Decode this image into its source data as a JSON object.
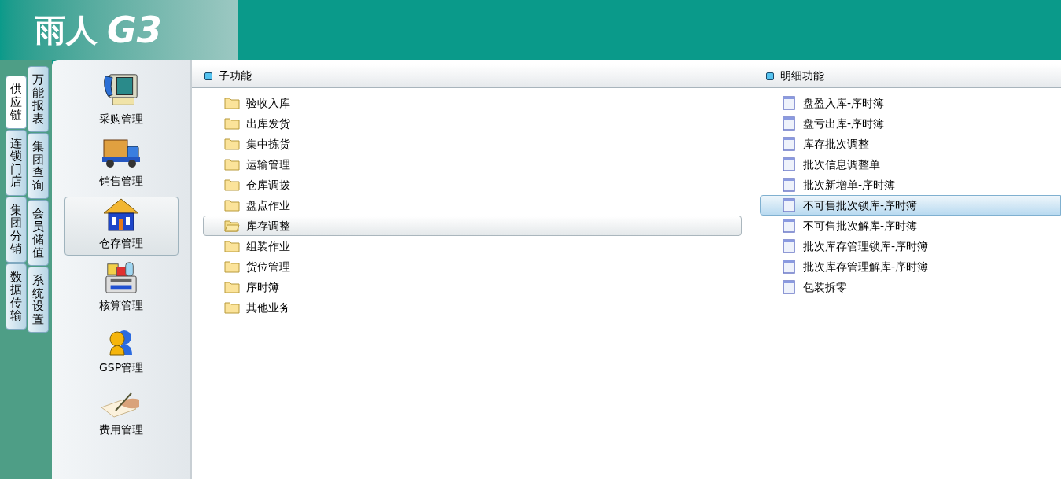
{
  "header": {
    "logo_text": "雨人",
    "logo_mark": "G3"
  },
  "outer_tabs": [
    {
      "label": "供应链",
      "selected": true
    },
    {
      "label": "连锁门店",
      "selected": false
    },
    {
      "label": "集团分销",
      "selected": false
    },
    {
      "label": "数据传输",
      "selected": false
    }
  ],
  "inner_tabs": [
    {
      "label": "万能报表",
      "selected": false
    },
    {
      "label": "集团查询",
      "selected": false
    },
    {
      "label": "会员储值",
      "selected": false
    },
    {
      "label": "系统设置",
      "selected": false
    }
  ],
  "modules": [
    {
      "label": "采购管理",
      "selected": false
    },
    {
      "label": "销售管理",
      "selected": false
    },
    {
      "label": "仓存管理",
      "selected": true
    },
    {
      "label": "核算管理",
      "selected": false
    },
    {
      "label": "GSP管理",
      "selected": false
    },
    {
      "label": "费用管理",
      "selected": false
    }
  ],
  "sub_panel": {
    "title": "子功能",
    "items": [
      {
        "label": "验收入库",
        "selected": false
      },
      {
        "label": "出库发货",
        "selected": false
      },
      {
        "label": "集中拣货",
        "selected": false
      },
      {
        "label": "运输管理",
        "selected": false
      },
      {
        "label": "仓库调拨",
        "selected": false
      },
      {
        "label": "盘点作业",
        "selected": false
      },
      {
        "label": "库存调整",
        "selected": true
      },
      {
        "label": "组装作业",
        "selected": false
      },
      {
        "label": "货位管理",
        "selected": false
      },
      {
        "label": "序时簿",
        "selected": false
      },
      {
        "label": "其他业务",
        "selected": false
      }
    ]
  },
  "detail_panel": {
    "title": "明细功能",
    "items": [
      {
        "label": "盘盈入库-序时簿",
        "selected": false
      },
      {
        "label": "盘亏出库-序时簿",
        "selected": false
      },
      {
        "label": "库存批次调整",
        "selected": false
      },
      {
        "label": "批次信息调整单",
        "selected": false
      },
      {
        "label": "批次新增单-序时簿",
        "selected": false
      },
      {
        "label": "不可售批次锁库-序时簿",
        "selected": true
      },
      {
        "label": "不可售批次解库-序时簿",
        "selected": false
      },
      {
        "label": "批次库存管理锁库-序时簿",
        "selected": false
      },
      {
        "label": "批次库存管理解库-序时簿",
        "selected": false
      },
      {
        "label": "包装拆零",
        "selected": false
      }
    ]
  }
}
